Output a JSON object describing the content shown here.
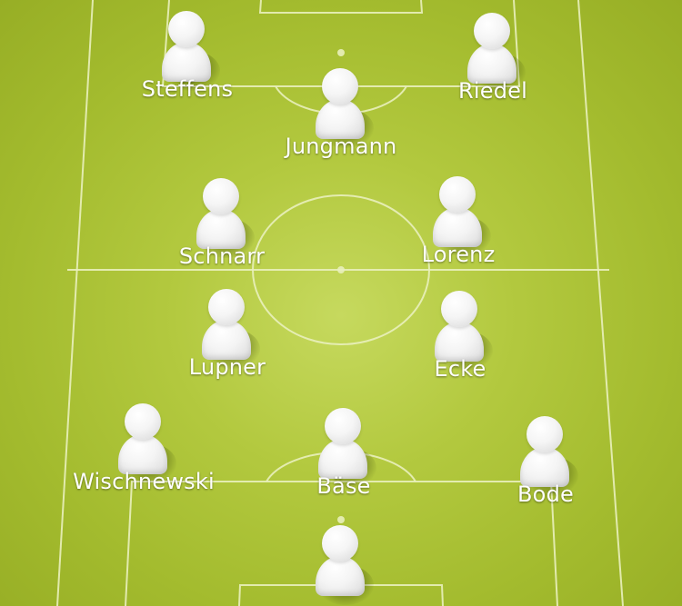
{
  "formation": {
    "players": [
      {
        "name": "Steffens"
      },
      {
        "name": "Riedel"
      },
      {
        "name": "Jungmann"
      },
      {
        "name": "Schnarr"
      },
      {
        "name": "Lorenz"
      },
      {
        "name": "Lupner"
      },
      {
        "name": "Ecke"
      },
      {
        "name": "Wischnewski"
      },
      {
        "name": "Bäse"
      },
      {
        "name": "Bode"
      },
      {
        "name": ""
      }
    ]
  },
  "colors": {
    "pitch": "#b3c93f",
    "lines": "#e8efb8",
    "player": "#f4f4f4",
    "label": "#ffffff"
  },
  "icons": {
    "player": "person-icon"
  }
}
